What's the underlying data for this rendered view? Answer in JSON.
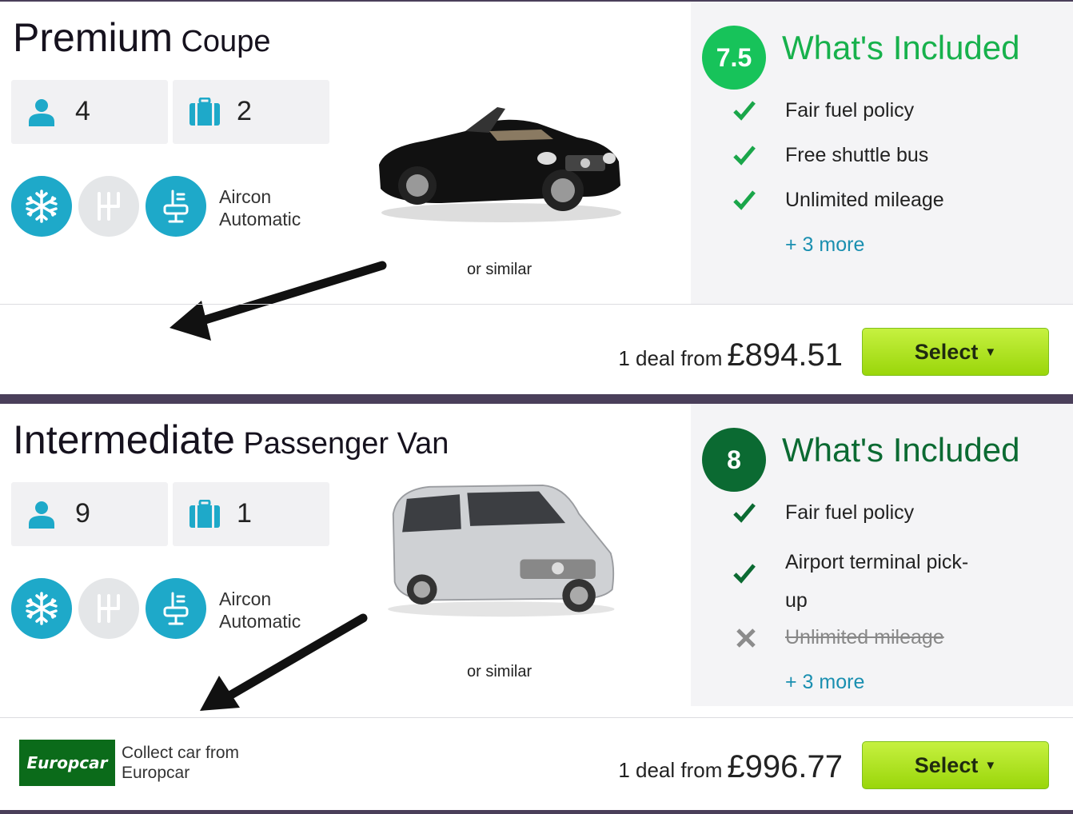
{
  "colors": {
    "accent_teal": "#1ea9c9",
    "rating_green_light": "#17c35a",
    "rating_green_dark": "#0b6a32",
    "check_green": "#1aa64a",
    "cross_gray": "#8c8c8c",
    "link_blue": "#1a8fb0",
    "select_green": "#a8e11a",
    "supplier_green": "#0b6b1a"
  },
  "cars": [
    {
      "class": "Premium",
      "type": "Coupe",
      "passengers": "4",
      "bags": "2",
      "feature_icons": [
        "snowflake-icon",
        "manual-gearbox-icon",
        "automatic-gearbox-icon"
      ],
      "features": [
        "Aircon",
        "Automatic"
      ],
      "image_label": "black-convertible-coupe",
      "similar": "or similar",
      "rating": "7.5",
      "included_title": "What's Included",
      "included": [
        {
          "label": "Fair fuel policy",
          "status": "check"
        },
        {
          "label": "Free shuttle bus",
          "status": "check"
        },
        {
          "label": "Unlimited mileage",
          "status": "check"
        }
      ],
      "more": "+ 3 more",
      "deal_text": "1 deal from",
      "price": "£894.51",
      "select_label": "Select"
    },
    {
      "class": "Intermediate",
      "type": "Passenger Van",
      "passengers": "9",
      "bags": "1",
      "feature_icons": [
        "snowflake-icon",
        "manual-gearbox-icon",
        "automatic-gearbox-icon"
      ],
      "features": [
        "Aircon",
        "Automatic"
      ],
      "image_label": "silver-passenger-van",
      "similar": "or similar",
      "rating": "8",
      "included_title": "What's Included",
      "included": [
        {
          "label": "Fair fuel policy",
          "status": "check"
        },
        {
          "label_line1": "Airport terminal pick-",
          "label_line2": "up",
          "status": "check"
        },
        {
          "label": "Unlimited mileage",
          "status": "cross"
        }
      ],
      "more": "+ 3 more",
      "supplier": {
        "logo_text": "Europcar",
        "line1": "Collect car from",
        "line2": "Europcar"
      },
      "deal_text": "1 deal from",
      "price": "£996.77",
      "select_label": "Select"
    }
  ]
}
